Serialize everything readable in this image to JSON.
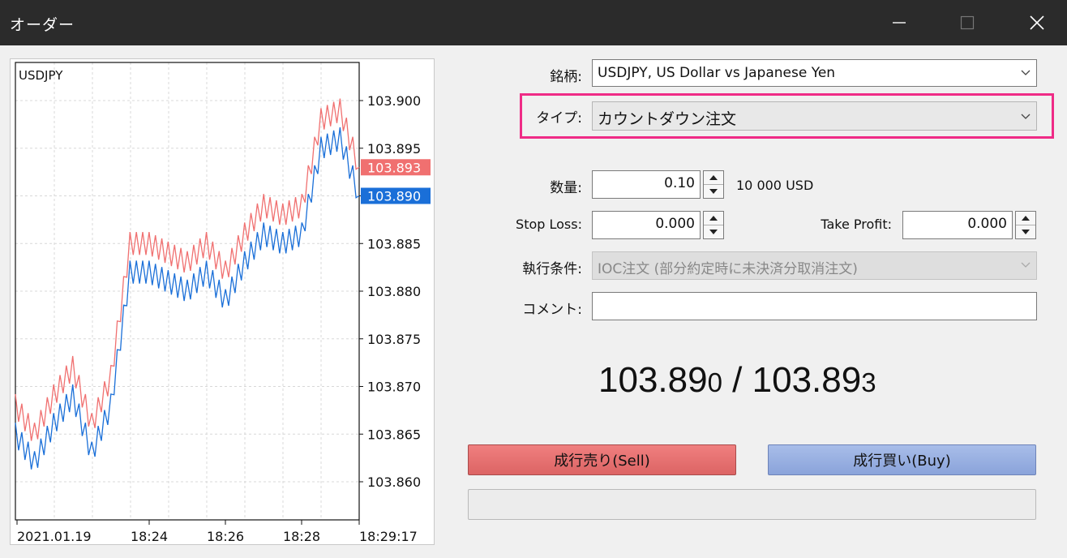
{
  "window": {
    "title": "オーダー",
    "min_icon": "minimize-icon",
    "max_icon": "maximize-icon",
    "close_icon": "close-icon"
  },
  "chart": {
    "symbol": "USDJPY",
    "price_ticks": [
      "103.900",
      "103.895",
      "103.890",
      "103.885",
      "103.880",
      "103.875",
      "103.870",
      "103.865",
      "103.860"
    ],
    "ask_marker": "103.893",
    "bid_marker": "103.890",
    "time_labels": [
      "2021.01.19",
      "18:24",
      "18:26",
      "18:28",
      "18:29:17"
    ],
    "ask_color": "#f07070",
    "bid_color": "#1a6fd8"
  },
  "chart_data": {
    "type": "line",
    "title": "USDJPY",
    "xlabel": "",
    "ylabel": "",
    "ylim": [
      103.856,
      103.904
    ],
    "grid": true,
    "series": [
      {
        "values": [
          103.868,
          103.865,
          103.869,
          103.872,
          103.866,
          103.871,
          103.885,
          103.885,
          103.884,
          103.883,
          103.885,
          103.882,
          103.886,
          103.889,
          103.888,
          103.889,
          103.898,
          103.899,
          103.893
        ]
      },
      {
        "values": [
          103.865,
          103.862,
          103.866,
          103.869,
          103.863,
          103.868,
          103.882,
          103.882,
          103.881,
          103.88,
          103.882,
          103.879,
          103.883,
          103.886,
          103.885,
          103.886,
          103.895,
          103.896,
          103.89
        ]
      }
    ]
  },
  "form": {
    "symbol_label": "銘柄:",
    "symbol_value": "USDJPY, US Dollar vs Japanese Yen",
    "type_label": "タイプ:",
    "type_value": "カウントダウン注文",
    "volume_label": "数量:",
    "volume_value": "0.10",
    "volume_unit": "10 000 USD",
    "sl_label": "Stop Loss:",
    "sl_value": "0.000",
    "tp_label": "Take Profit:",
    "tp_value": "0.000",
    "exec_label": "執行条件:",
    "exec_value": "IOC注文 (部分約定時に未決済分取消注文)",
    "comment_label": "コメント:",
    "comment_value": ""
  },
  "quote": {
    "bid_main": "103.89",
    "bid_small": "0",
    "separator": " / ",
    "ask_main": "103.89",
    "ask_small": "3"
  },
  "buttons": {
    "sell": "成行売り(Sell)",
    "buy": "成行買い(Buy)"
  },
  "highlight_color": "#ef2b86"
}
